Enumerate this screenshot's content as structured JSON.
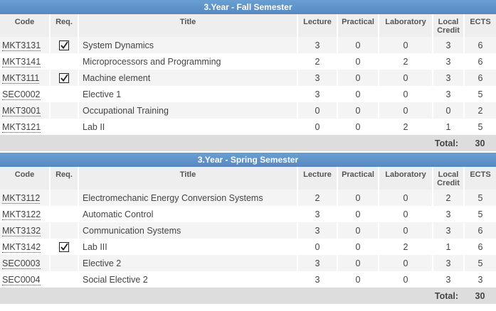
{
  "headers": {
    "code": "Code",
    "req": "Req.",
    "title": "Title",
    "lecture": "Lecture",
    "practical": "Practical",
    "laboratory": "Laboratory",
    "local_credit": "Local Credit",
    "ects": "ECTS"
  },
  "total_label": "Total:",
  "semesters": [
    {
      "title": "3.Year - Fall Semester",
      "total_ects": "30",
      "courses": [
        {
          "code": "MKT3131",
          "req": true,
          "title": "System Dynamics",
          "lecture": "3",
          "practical": "0",
          "laboratory": "0",
          "local_credit": "3",
          "ects": "6"
        },
        {
          "code": "MKT3141",
          "req": false,
          "title": "Microprocessors and Programming",
          "lecture": "2",
          "practical": "0",
          "laboratory": "2",
          "local_credit": "3",
          "ects": "6"
        },
        {
          "code": "MKT3111",
          "req": true,
          "title": "Machine element",
          "lecture": "3",
          "practical": "0",
          "laboratory": "0",
          "local_credit": "3",
          "ects": "6"
        },
        {
          "code": "SEC0002",
          "req": false,
          "title": "Elective 1",
          "lecture": "3",
          "practical": "0",
          "laboratory": "0",
          "local_credit": "3",
          "ects": "5"
        },
        {
          "code": "MKT3001",
          "req": false,
          "title": "Occupational Training",
          "lecture": "0",
          "practical": "0",
          "laboratory": "0",
          "local_credit": "0",
          "ects": "2"
        },
        {
          "code": "MKT3121",
          "req": false,
          "title": "Lab II",
          "lecture": "0",
          "practical": "0",
          "laboratory": "2",
          "local_credit": "1",
          "ects": "5"
        }
      ]
    },
    {
      "title": "3.Year - Spring Semester",
      "total_ects": "30",
      "courses": [
        {
          "code": "MKT3112",
          "req": false,
          "title": "Electromechanic Energy Conversion Systems",
          "lecture": "2",
          "practical": "0",
          "laboratory": "0",
          "local_credit": "2",
          "ects": "5"
        },
        {
          "code": "MKT3122",
          "req": false,
          "title": "Automatic Control",
          "lecture": "3",
          "practical": "0",
          "laboratory": "0",
          "local_credit": "3",
          "ects": "5"
        },
        {
          "code": "MKT3132",
          "req": false,
          "title": "Communication Systems",
          "lecture": "3",
          "practical": "0",
          "laboratory": "0",
          "local_credit": "3",
          "ects": "6"
        },
        {
          "code": "MKT3142",
          "req": true,
          "title": "Lab III",
          "lecture": "0",
          "practical": "0",
          "laboratory": "2",
          "local_credit": "1",
          "ects": "6"
        },
        {
          "code": "SEC0003",
          "req": false,
          "title": "Elective 2",
          "lecture": "3",
          "practical": "0",
          "laboratory": "0",
          "local_credit": "3",
          "ects": "5"
        },
        {
          "code": "SEC0004",
          "req": false,
          "title": "Social Elective 2",
          "lecture": "3",
          "practical": "0",
          "laboratory": "0",
          "local_credit": "3",
          "ects": "3"
        }
      ]
    }
  ]
}
